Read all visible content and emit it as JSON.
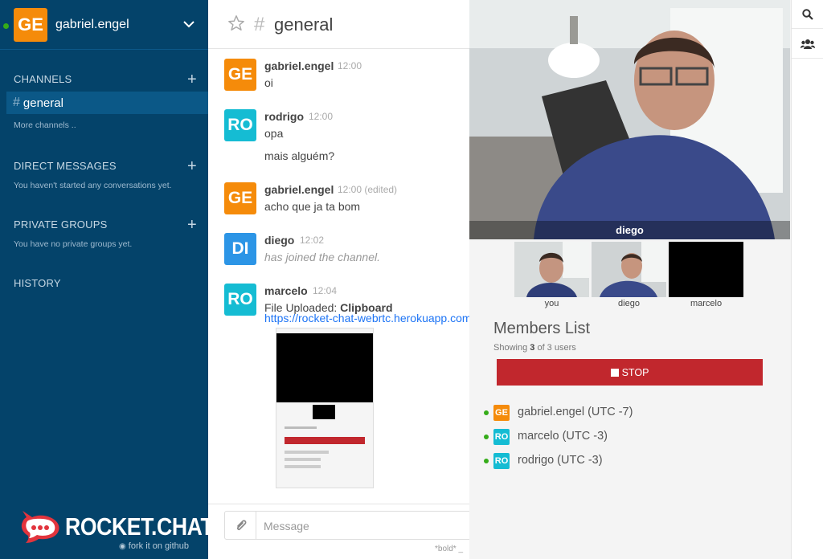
{
  "sidebar": {
    "user": {
      "initials": "GE",
      "name": "gabriel.engel",
      "avatar_color": "#f58b0a",
      "status_color": "#35ac19"
    },
    "channels": {
      "title": "CHANNELS",
      "items": [
        {
          "label": "general"
        }
      ],
      "more": "More channels .."
    },
    "direct_messages": {
      "title": "DIRECT MESSAGES",
      "empty": "You haven't started any conversations yet."
    },
    "private_groups": {
      "title": "PRIVATE GROUPS",
      "empty": "You have no private groups yet."
    },
    "history": {
      "title": "HISTORY"
    },
    "logo_text": "ROCKET.CHAT",
    "fork_text": "fork it on github"
  },
  "room": {
    "name": "general",
    "messages": [
      {
        "initials": "GE",
        "color": "#f58b0a",
        "user": "gabriel.engel",
        "time": "12:00",
        "lines": [
          "oi"
        ]
      },
      {
        "initials": "RO",
        "color": "#15bcd3",
        "user": "rodrigo",
        "time": "12:00",
        "lines": [
          "opa",
          "mais alguém?"
        ]
      },
      {
        "initials": "GE",
        "color": "#f58b0a",
        "user": "gabriel.engel",
        "time": "12:00 (edited)",
        "lines": [
          "acho que ja ta bom"
        ]
      },
      {
        "initials": "DI",
        "color": "#2c95e6",
        "user": "diego",
        "time": "12:02",
        "lines": [
          "has joined the channel."
        ]
      },
      {
        "initials": "RO",
        "color": "#15bcd3",
        "user": "marcelo",
        "time": "12:04",
        "file_label": "File Uploaded: ",
        "file_name": "Clipboard",
        "link": "https://rocket-chat-webrtc.herokuapp.com"
      }
    ],
    "composer": {
      "placeholder": "Message",
      "hint": "*bold*  _"
    }
  },
  "video": {
    "main_label": "diego",
    "thumbs": [
      {
        "label": "you"
      },
      {
        "label": "diego"
      },
      {
        "label": "marcelo"
      }
    ],
    "members_title": "Members List",
    "showing_prefix": "Showing ",
    "showing_count": "3",
    "showing_suffix": " of 3 users",
    "stop_label": "STOP",
    "stop_color": "#c1272d",
    "members": [
      {
        "initials": "GE",
        "color": "#f58b0a",
        "label": "gabriel.engel (UTC -7)"
      },
      {
        "initials": "RO",
        "color": "#15bcd3",
        "label": "marcelo (UTC -3)"
      },
      {
        "initials": "RO",
        "color": "#15bcd3",
        "label": "rodrigo (UTC -3)"
      }
    ]
  },
  "right_bar": {
    "icons": [
      "search-icon",
      "members-icon"
    ]
  }
}
